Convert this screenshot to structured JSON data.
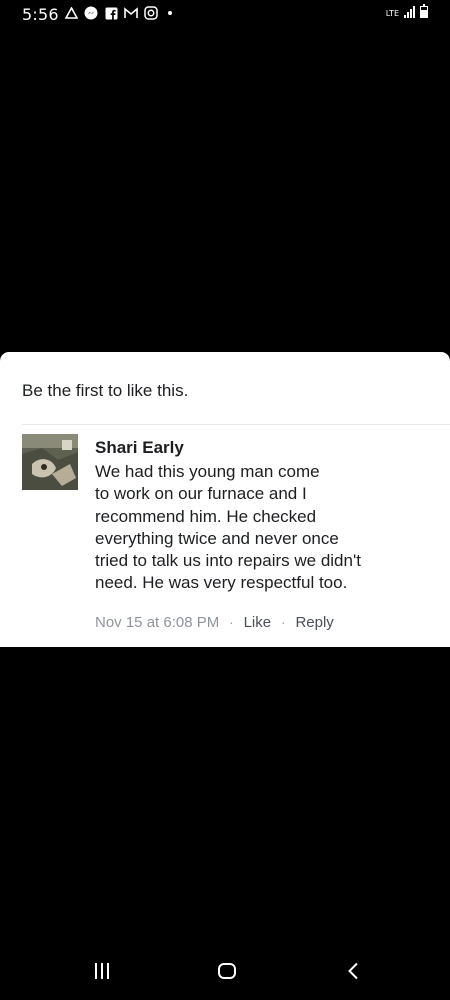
{
  "status_bar": {
    "time": "5:56",
    "network": "LTE",
    "notification_icons": [
      "drive-icon",
      "messenger-icon",
      "facebook-icon",
      "gmail-icon",
      "instagram-icon"
    ]
  },
  "post": {
    "likes_text": "Be the first to like this.",
    "comment": {
      "author": "Shari Early",
      "lines": [
        "We had this young man come",
        "to work on our furnace and I",
        "recommend him. He checked",
        "everything twice and never once",
        "tried to talk us into repairs we didn't",
        "need. He was very respectful too."
      ],
      "timestamp": "Nov 15 at 6:08 PM",
      "separator": "·",
      "like_label": "Like",
      "reply_label": "Reply"
    }
  },
  "colors": {
    "background": "#000000",
    "card": "#ffffff",
    "text": "#1c1e21",
    "meta_gray": "#90949c"
  }
}
